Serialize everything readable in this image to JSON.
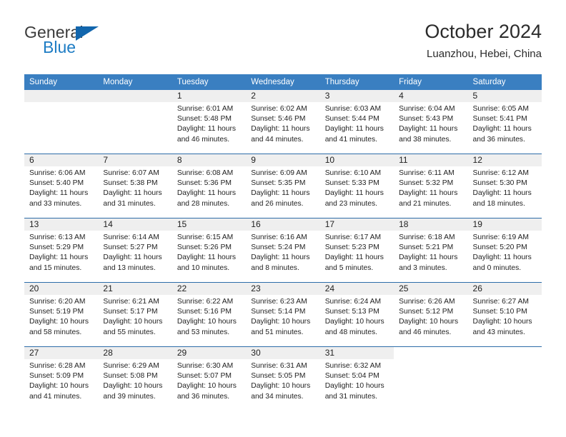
{
  "brand": {
    "name_top": "General",
    "name_bottom": "Blue",
    "triangle_color": "#1266ad",
    "blue_color": "#1d7cc4"
  },
  "header": {
    "title": "October 2024",
    "location": "Luanzhou, Hebei, China"
  },
  "theme": {
    "header_row_bg": "#3a7fc1",
    "week_rule": "#2d6ca8",
    "day_number_band": "#efefef"
  },
  "weekdays": [
    "Sunday",
    "Monday",
    "Tuesday",
    "Wednesday",
    "Thursday",
    "Friday",
    "Saturday"
  ],
  "weeks": [
    [
      {
        "day": "",
        "lines": [
          "",
          "",
          "",
          ""
        ]
      },
      {
        "day": "",
        "lines": [
          "",
          "",
          "",
          ""
        ]
      },
      {
        "day": "1",
        "lines": [
          "Sunrise: 6:01 AM",
          "Sunset: 5:48 PM",
          "Daylight: 11 hours",
          "and 46 minutes."
        ]
      },
      {
        "day": "2",
        "lines": [
          "Sunrise: 6:02 AM",
          "Sunset: 5:46 PM",
          "Daylight: 11 hours",
          "and 44 minutes."
        ]
      },
      {
        "day": "3",
        "lines": [
          "Sunrise: 6:03 AM",
          "Sunset: 5:44 PM",
          "Daylight: 11 hours",
          "and 41 minutes."
        ]
      },
      {
        "day": "4",
        "lines": [
          "Sunrise: 6:04 AM",
          "Sunset: 5:43 PM",
          "Daylight: 11 hours",
          "and 38 minutes."
        ]
      },
      {
        "day": "5",
        "lines": [
          "Sunrise: 6:05 AM",
          "Sunset: 5:41 PM",
          "Daylight: 11 hours",
          "and 36 minutes."
        ]
      }
    ],
    [
      {
        "day": "6",
        "lines": [
          "Sunrise: 6:06 AM",
          "Sunset: 5:40 PM",
          "Daylight: 11 hours",
          "and 33 minutes."
        ]
      },
      {
        "day": "7",
        "lines": [
          "Sunrise: 6:07 AM",
          "Sunset: 5:38 PM",
          "Daylight: 11 hours",
          "and 31 minutes."
        ]
      },
      {
        "day": "8",
        "lines": [
          "Sunrise: 6:08 AM",
          "Sunset: 5:36 PM",
          "Daylight: 11 hours",
          "and 28 minutes."
        ]
      },
      {
        "day": "9",
        "lines": [
          "Sunrise: 6:09 AM",
          "Sunset: 5:35 PM",
          "Daylight: 11 hours",
          "and 26 minutes."
        ]
      },
      {
        "day": "10",
        "lines": [
          "Sunrise: 6:10 AM",
          "Sunset: 5:33 PM",
          "Daylight: 11 hours",
          "and 23 minutes."
        ]
      },
      {
        "day": "11",
        "lines": [
          "Sunrise: 6:11 AM",
          "Sunset: 5:32 PM",
          "Daylight: 11 hours",
          "and 21 minutes."
        ]
      },
      {
        "day": "12",
        "lines": [
          "Sunrise: 6:12 AM",
          "Sunset: 5:30 PM",
          "Daylight: 11 hours",
          "and 18 minutes."
        ]
      }
    ],
    [
      {
        "day": "13",
        "lines": [
          "Sunrise: 6:13 AM",
          "Sunset: 5:29 PM",
          "Daylight: 11 hours",
          "and 15 minutes."
        ]
      },
      {
        "day": "14",
        "lines": [
          "Sunrise: 6:14 AM",
          "Sunset: 5:27 PM",
          "Daylight: 11 hours",
          "and 13 minutes."
        ]
      },
      {
        "day": "15",
        "lines": [
          "Sunrise: 6:15 AM",
          "Sunset: 5:26 PM",
          "Daylight: 11 hours",
          "and 10 minutes."
        ]
      },
      {
        "day": "16",
        "lines": [
          "Sunrise: 6:16 AM",
          "Sunset: 5:24 PM",
          "Daylight: 11 hours",
          "and 8 minutes."
        ]
      },
      {
        "day": "17",
        "lines": [
          "Sunrise: 6:17 AM",
          "Sunset: 5:23 PM",
          "Daylight: 11 hours",
          "and 5 minutes."
        ]
      },
      {
        "day": "18",
        "lines": [
          "Sunrise: 6:18 AM",
          "Sunset: 5:21 PM",
          "Daylight: 11 hours",
          "and 3 minutes."
        ]
      },
      {
        "day": "19",
        "lines": [
          "Sunrise: 6:19 AM",
          "Sunset: 5:20 PM",
          "Daylight: 11 hours",
          "and 0 minutes."
        ]
      }
    ],
    [
      {
        "day": "20",
        "lines": [
          "Sunrise: 6:20 AM",
          "Sunset: 5:19 PM",
          "Daylight: 10 hours",
          "and 58 minutes."
        ]
      },
      {
        "day": "21",
        "lines": [
          "Sunrise: 6:21 AM",
          "Sunset: 5:17 PM",
          "Daylight: 10 hours",
          "and 55 minutes."
        ]
      },
      {
        "day": "22",
        "lines": [
          "Sunrise: 6:22 AM",
          "Sunset: 5:16 PM",
          "Daylight: 10 hours",
          "and 53 minutes."
        ]
      },
      {
        "day": "23",
        "lines": [
          "Sunrise: 6:23 AM",
          "Sunset: 5:14 PM",
          "Daylight: 10 hours",
          "and 51 minutes."
        ]
      },
      {
        "day": "24",
        "lines": [
          "Sunrise: 6:24 AM",
          "Sunset: 5:13 PM",
          "Daylight: 10 hours",
          "and 48 minutes."
        ]
      },
      {
        "day": "25",
        "lines": [
          "Sunrise: 6:26 AM",
          "Sunset: 5:12 PM",
          "Daylight: 10 hours",
          "and 46 minutes."
        ]
      },
      {
        "day": "26",
        "lines": [
          "Sunrise: 6:27 AM",
          "Sunset: 5:10 PM",
          "Daylight: 10 hours",
          "and 43 minutes."
        ]
      }
    ],
    [
      {
        "day": "27",
        "lines": [
          "Sunrise: 6:28 AM",
          "Sunset: 5:09 PM",
          "Daylight: 10 hours",
          "and 41 minutes."
        ]
      },
      {
        "day": "28",
        "lines": [
          "Sunrise: 6:29 AM",
          "Sunset: 5:08 PM",
          "Daylight: 10 hours",
          "and 39 minutes."
        ]
      },
      {
        "day": "29",
        "lines": [
          "Sunrise: 6:30 AM",
          "Sunset: 5:07 PM",
          "Daylight: 10 hours",
          "and 36 minutes."
        ]
      },
      {
        "day": "30",
        "lines": [
          "Sunrise: 6:31 AM",
          "Sunset: 5:05 PM",
          "Daylight: 10 hours",
          "and 34 minutes."
        ]
      },
      {
        "day": "31",
        "lines": [
          "Sunrise: 6:32 AM",
          "Sunset: 5:04 PM",
          "Daylight: 10 hours",
          "and 31 minutes."
        ]
      },
      {
        "day": "",
        "lines": [
          "",
          "",
          "",
          ""
        ]
      },
      {
        "day": "",
        "lines": [
          "",
          "",
          "",
          ""
        ]
      }
    ]
  ]
}
